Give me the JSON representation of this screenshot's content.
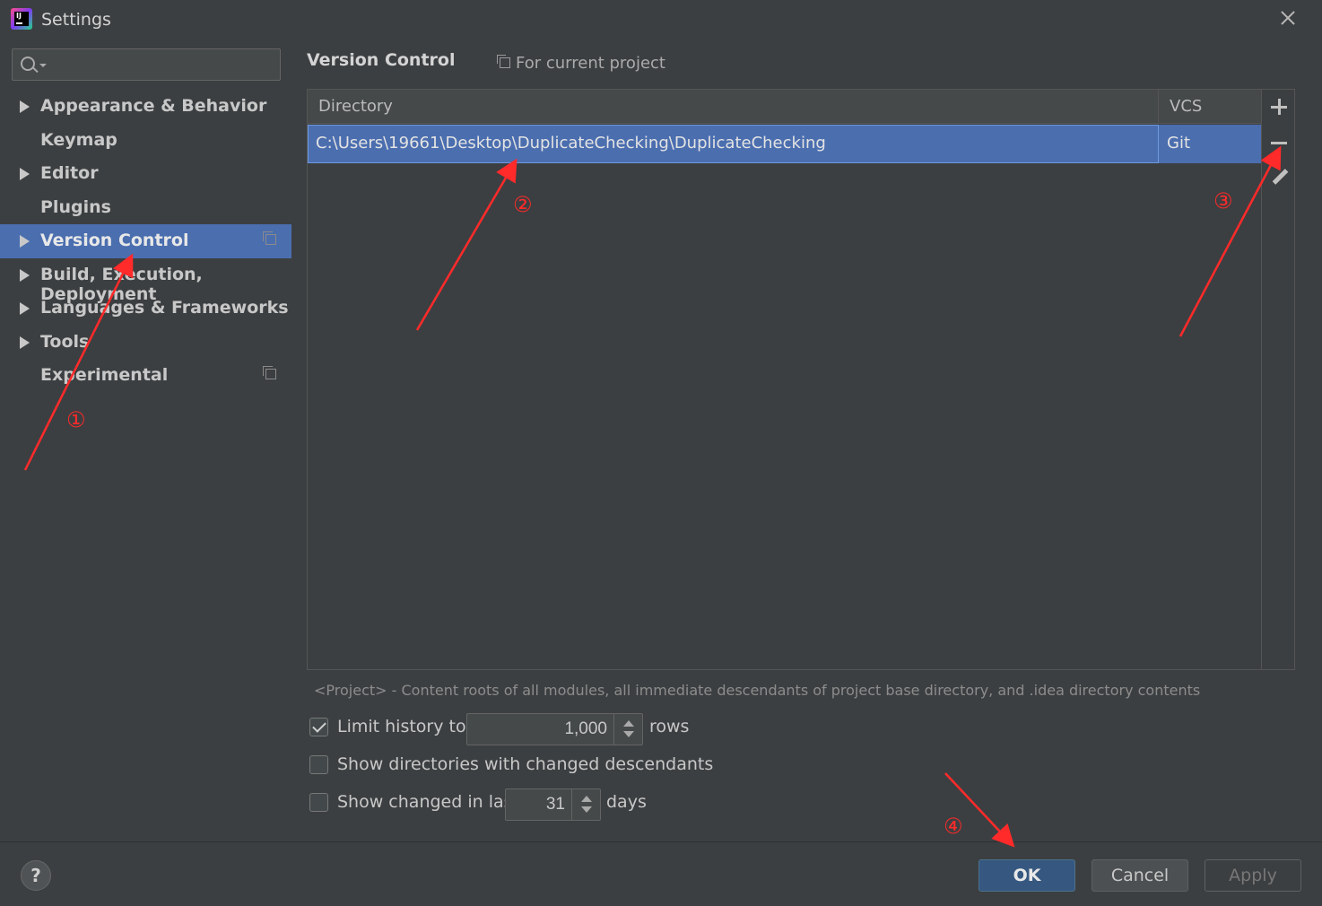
{
  "window": {
    "title": "Settings"
  },
  "sidebar": {
    "search_value": "",
    "items": [
      {
        "label": "Appearance & Behavior",
        "expandable": true,
        "selected": false,
        "project_scoped": false
      },
      {
        "label": "Keymap",
        "expandable": false,
        "selected": false,
        "project_scoped": false
      },
      {
        "label": "Editor",
        "expandable": true,
        "selected": false,
        "project_scoped": false
      },
      {
        "label": "Plugins",
        "expandable": false,
        "selected": false,
        "project_scoped": false
      },
      {
        "label": "Version Control",
        "expandable": true,
        "selected": true,
        "project_scoped": true
      },
      {
        "label": "Build, Execution, Deployment",
        "expandable": true,
        "selected": false,
        "project_scoped": false
      },
      {
        "label": "Languages & Frameworks",
        "expandable": true,
        "selected": false,
        "project_scoped": false
      },
      {
        "label": "Tools",
        "expandable": true,
        "selected": false,
        "project_scoped": false
      },
      {
        "label": "Experimental",
        "expandable": false,
        "selected": false,
        "project_scoped": true
      }
    ]
  },
  "main": {
    "title": "Version Control",
    "scope": "For current project",
    "table": {
      "columns": [
        "Directory",
        "VCS"
      ],
      "rows": [
        {
          "directory": "C:\\Users\\19661\\Desktop\\DuplicateChecking\\DuplicateChecking",
          "vcs": "Git"
        }
      ]
    },
    "hint": "<Project> - Content roots of all modules, all immediate descendants of project base directory, and .idea directory contents",
    "options": {
      "limit_history": {
        "checked": true,
        "label": "Limit history to:",
        "value": "1,000",
        "suffix": "rows"
      },
      "show_dirs": {
        "checked": false,
        "label": "Show directories with changed descendants"
      },
      "show_changed": {
        "checked": false,
        "label": "Show changed in last",
        "value": "31",
        "suffix": "days"
      }
    }
  },
  "footer": {
    "help_label": "?",
    "ok_label": "OK",
    "cancel_label": "Cancel",
    "apply_label": "Apply"
  },
  "annotations": {
    "markers": [
      "①",
      "②",
      "③",
      "④"
    ],
    "color": "#ff2a2a"
  },
  "colors": {
    "background": "#3c3f41",
    "selection": "#4b6eaf",
    "ok_button": "#365880"
  }
}
